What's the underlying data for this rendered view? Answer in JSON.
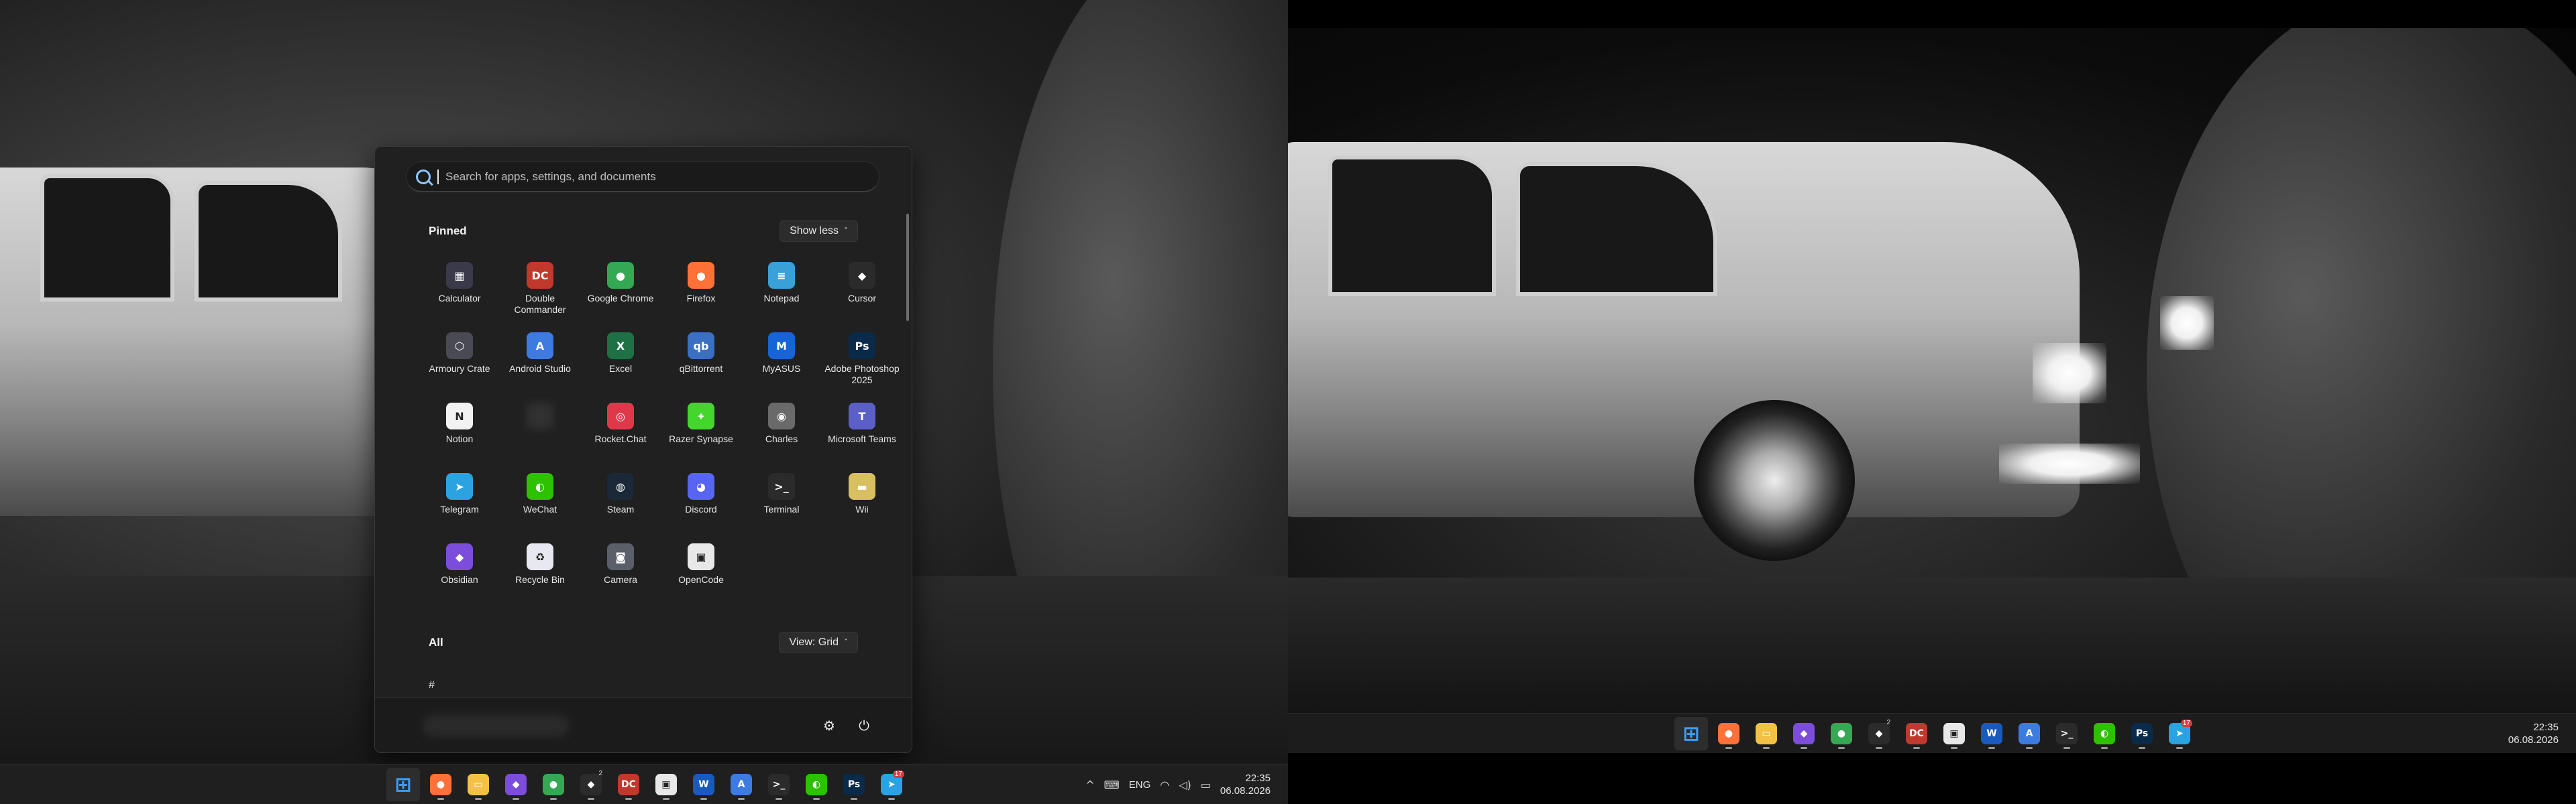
{
  "left_monitor": {
    "start_menu": {
      "search_placeholder": "Search for apps, settings, and documents",
      "pinned_title": "Pinned",
      "show_less_label": "Show less",
      "all_title": "All",
      "view_label": "View: Grid",
      "letter_group": "#",
      "pinned_apps": [
        {
          "label": "Calculator",
          "icon": "calculator-icon",
          "color": "#3a3a4a",
          "glyph": "▦"
        },
        {
          "label": "Double Commander",
          "icon": "double-commander-icon",
          "color": "#c0392b",
          "glyph": "DC"
        },
        {
          "label": "Google Chrome",
          "icon": "chrome-icon",
          "color": "#34a853",
          "glyph": "●"
        },
        {
          "label": "Firefox",
          "icon": "firefox-icon",
          "color": "#ff7139",
          "glyph": "●"
        },
        {
          "label": "Notepad",
          "icon": "notepad-icon",
          "color": "#3aa0d8",
          "glyph": "≡"
        },
        {
          "label": "Cursor",
          "icon": "cursor-icon",
          "color": "#2b2b2b",
          "glyph": "◆"
        },
        {
          "label": "Armoury Crate",
          "icon": "armoury-crate-icon",
          "color": "#4a4a55",
          "glyph": "⬡"
        },
        {
          "label": "Android Studio",
          "icon": "android-studio-icon",
          "color": "#3d7be0",
          "glyph": "A"
        },
        {
          "label": "Excel",
          "icon": "excel-icon",
          "color": "#1e7145",
          "glyph": "X"
        },
        {
          "label": "qBittorrent",
          "icon": "qbittorrent-icon",
          "color": "#3b6fc4",
          "glyph": "qb"
        },
        {
          "label": "MyASUS",
          "icon": "myasus-icon",
          "color": "#1565d8",
          "glyph": "M"
        },
        {
          "label": "Adobe Photoshop 2025",
          "icon": "photoshop-icon",
          "color": "#0a2a4a",
          "glyph": "Ps"
        },
        {
          "label": "Notion",
          "icon": "notion-icon",
          "color": "#f2f2f2",
          "glyph": "N"
        },
        {
          "label": "",
          "icon": "blurred-app-icon",
          "color": "#333333",
          "glyph": ""
        },
        {
          "label": "Rocket.Chat",
          "icon": "rocket-chat-icon",
          "color": "#e0384a",
          "glyph": "◎"
        },
        {
          "label": "Razer Synapse",
          "icon": "razer-synapse-icon",
          "color": "#44d62c",
          "glyph": "✦"
        },
        {
          "label": "Charles",
          "icon": "charles-icon",
          "color": "#6a6a6a",
          "glyph": "◉"
        },
        {
          "label": "Microsoft Teams",
          "icon": "teams-icon",
          "color": "#5b5fc7",
          "glyph": "T"
        },
        {
          "label": "Telegram",
          "icon": "telegram-icon",
          "color": "#2aa3e0",
          "glyph": "➤"
        },
        {
          "label": "WeChat",
          "icon": "wechat-icon",
          "color": "#2dc100",
          "glyph": "◐"
        },
        {
          "label": "Steam",
          "icon": "steam-icon",
          "color": "#1b2838",
          "glyph": "◍"
        },
        {
          "label": "Discord",
          "icon": "discord-icon",
          "color": "#5865f2",
          "glyph": "◕"
        },
        {
          "label": "Terminal",
          "icon": "terminal-icon",
          "color": "#2b2b2b",
          "glyph": ">_"
        },
        {
          "label": "Wii",
          "icon": "wii-icon",
          "color": "#d8c060",
          "glyph": "▬"
        },
        {
          "label": "Obsidian",
          "icon": "obsidian-icon",
          "color": "#7c4ddb",
          "glyph": "◆"
        },
        {
          "label": "Recycle Bin",
          "icon": "recycle-bin-icon",
          "color": "#e8e8f0",
          "glyph": "♻"
        },
        {
          "label": "Camera",
          "icon": "camera-icon",
          "color": "#5a5f6a",
          "glyph": "◙"
        },
        {
          "label": "OpenCode",
          "icon": "opencode-icon",
          "color": "#e8e8e8",
          "glyph": "▣"
        }
      ]
    },
    "taskbar": {
      "apps": [
        {
          "name": "start-button",
          "icon": "windows-start-icon",
          "color": "#0078d4",
          "glyph": "⊞",
          "active": true
        },
        {
          "name": "taskbar-firefox",
          "icon": "firefox-icon",
          "color": "#ff7139",
          "glyph": "●",
          "dot": true
        },
        {
          "name": "taskbar-file-explorer",
          "icon": "folder-icon",
          "color": "#f3c244",
          "glyph": "▭",
          "dot": true
        },
        {
          "name": "taskbar-obsidian",
          "icon": "obsidian-icon",
          "color": "#7c4ddb",
          "glyph": "◆",
          "dot": true
        },
        {
          "name": "taskbar-chrome",
          "icon": "chrome-icon",
          "color": "#34a853",
          "glyph": "●",
          "dot": true
        },
        {
          "name": "taskbar-cursor",
          "icon": "cursor-icon",
          "color": "#2b2b2b",
          "glyph": "◆",
          "sup": "2",
          "dot": true
        },
        {
          "name": "taskbar-double-commander",
          "icon": "double-commander-icon",
          "color": "#c0392b",
          "glyph": "DC",
          "dot": true
        },
        {
          "name": "taskbar-opencode",
          "icon": "opencode-icon",
          "color": "#e8e8e8",
          "glyph": "▣",
          "dot": true
        },
        {
          "name": "taskbar-word",
          "icon": "word-icon",
          "color": "#185abd",
          "glyph": "W",
          "dot": true
        },
        {
          "name": "taskbar-android-studio",
          "icon": "android-studio-icon",
          "color": "#3d7be0",
          "glyph": "A",
          "dot": true
        },
        {
          "name": "taskbar-terminal",
          "icon": "terminal-icon",
          "color": "#2b2b2b",
          "glyph": ">_",
          "dot": true
        },
        {
          "name": "taskbar-wechat",
          "icon": "wechat-icon",
          "color": "#2dc100",
          "glyph": "◐",
          "dot": true
        },
        {
          "name": "taskbar-photoshop",
          "icon": "photoshop-icon",
          "color": "#0a2a4a",
          "glyph": "Ps",
          "dot": true
        },
        {
          "name": "taskbar-telegram",
          "icon": "telegram-icon",
          "color": "#2aa3e0",
          "glyph": "➤",
          "badge": "17",
          "dot": true
        }
      ],
      "tray": {
        "chevron": "^",
        "keyboard": "⌨",
        "language": "ENG",
        "wifi": "◠",
        "volume": "◁)",
        "battery": "▭"
      },
      "time": "22:35",
      "date": "06.08.2026"
    }
  },
  "right_monitor": {
    "taskbar": {
      "time": "22:35",
      "date": "06.08.2026"
    }
  }
}
